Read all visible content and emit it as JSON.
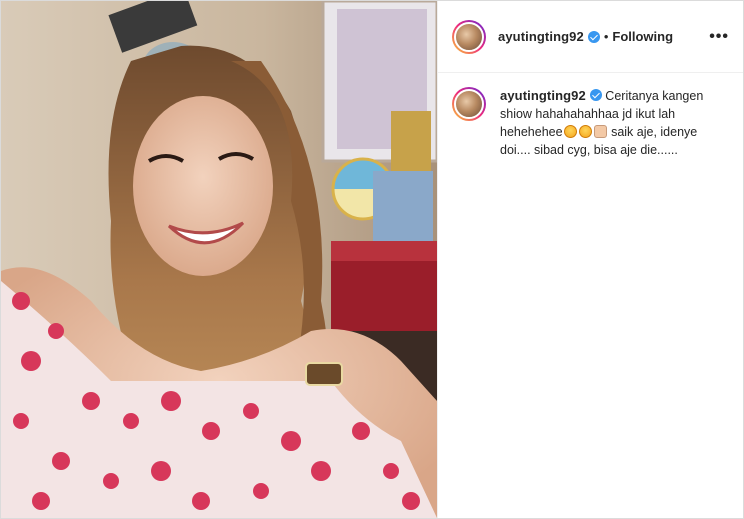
{
  "post": {
    "username": "ayutingting92",
    "follow_separator": "•",
    "follow_status": "Following",
    "more_label": "•••",
    "caption_text_1": "Ceritanya kangen shiow hahahahahhaa jd ikut lah hehehehee",
    "caption_text_2": "saik aje, idenye doi.... sibad cyg, bisa aje die......"
  },
  "icons": {
    "verified": "verified-badge-icon",
    "more": "more-options-icon",
    "emoji_1": "grinning-tongue-emoji",
    "emoji_2": "heart-eyes-emoji",
    "emoji_3": "clapping-hands-emoji"
  },
  "colors": {
    "accent_blue": "#3897f0",
    "text": "#262626"
  }
}
